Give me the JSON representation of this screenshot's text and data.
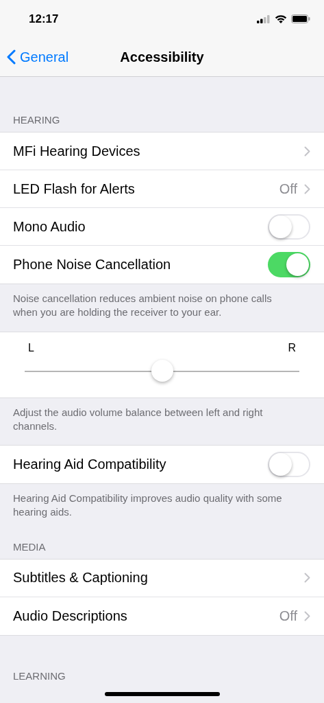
{
  "status_bar": {
    "time": "12:17"
  },
  "nav": {
    "back": "General",
    "title": "Accessibility"
  },
  "sections": [
    {
      "kind": "header",
      "text": "HEARING"
    },
    {
      "kind": "group",
      "rows": [
        {
          "kind": "disclosure",
          "label": "MFi Hearing Devices"
        },
        {
          "kind": "disclosure",
          "label": "LED Flash for Alerts",
          "value": "Off"
        },
        {
          "kind": "toggle",
          "label": "Mono Audio",
          "on": false
        },
        {
          "kind": "toggle",
          "label": "Phone Noise Cancellation",
          "on": true
        }
      ]
    },
    {
      "kind": "footer",
      "text": "Noise cancellation reduces ambient noise on phone calls when you are holding the receiver to your ear."
    },
    {
      "kind": "slider",
      "left": "L",
      "right": "R",
      "level": 0.5
    },
    {
      "kind": "footer",
      "text": "Adjust the audio volume balance between left and right channels."
    },
    {
      "kind": "group",
      "rows": [
        {
          "kind": "toggle",
          "label": "Hearing Aid Compatibility",
          "on": false
        }
      ]
    },
    {
      "kind": "footer",
      "text": "Hearing Aid Compatibility improves audio quality with some hearing aids."
    },
    {
      "kind": "header",
      "text": "MEDIA"
    },
    {
      "kind": "group",
      "rows": [
        {
          "kind": "disclosure",
          "label": "Subtitles & Captioning"
        },
        {
          "kind": "disclosure",
          "label": "Audio Descriptions",
          "value": "Off"
        }
      ]
    },
    {
      "kind": "header",
      "text": "LEARNING"
    }
  ]
}
